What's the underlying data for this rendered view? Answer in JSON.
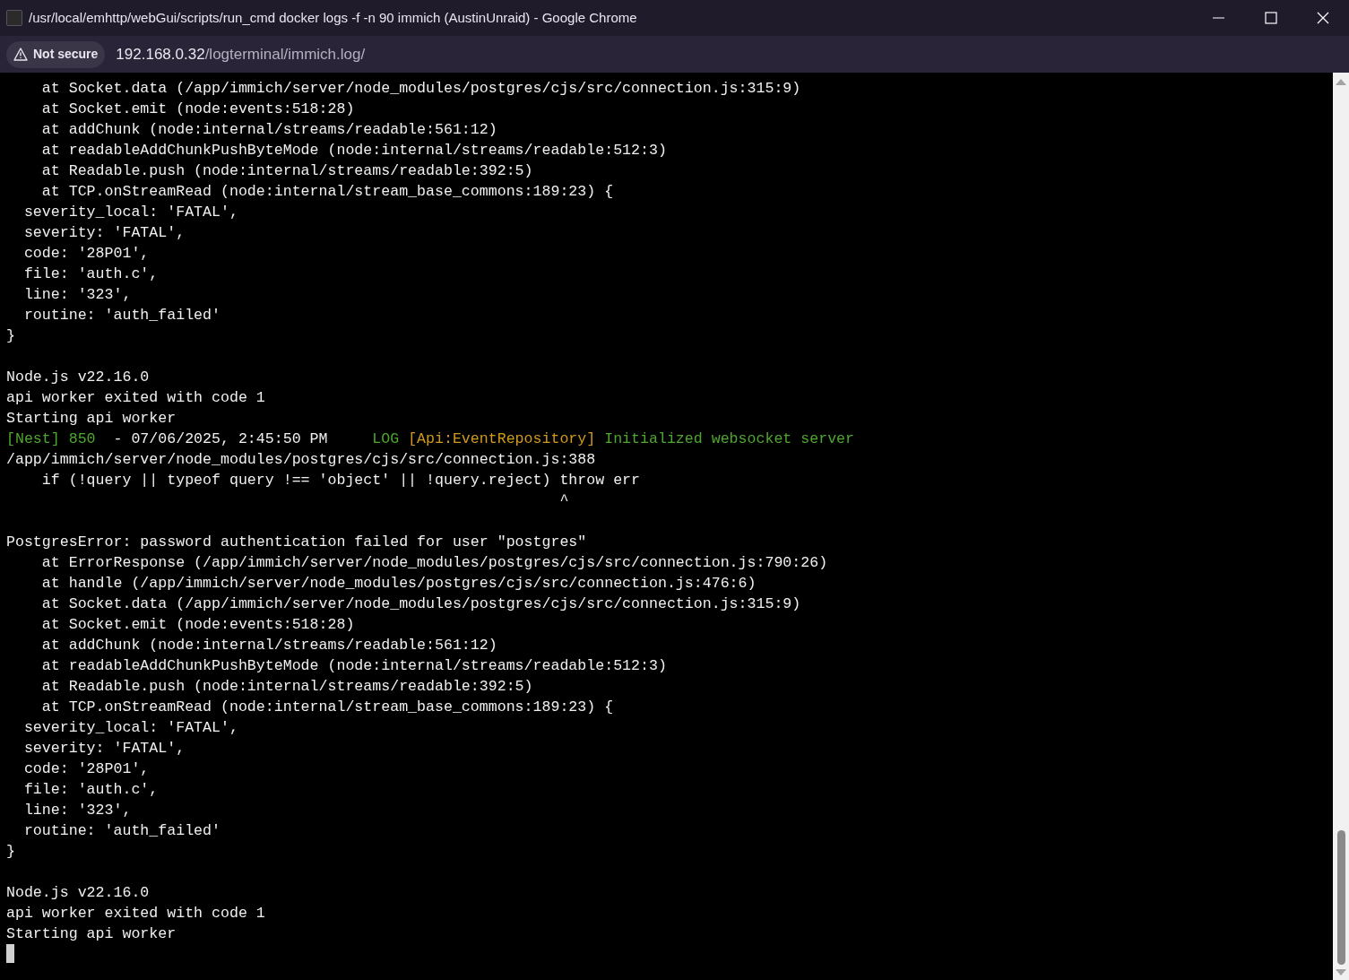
{
  "window": {
    "title": "/usr/local/emhttp/webGui/scripts/run_cmd docker logs -f -n 90 immich (AustinUnraid) - Google Chrome"
  },
  "address_bar": {
    "security": "Not secure",
    "url_host": "192.168.0.32",
    "url_path": "/logterminal/immich.log/"
  },
  "terminal": {
    "lines": [
      {
        "kind": "text",
        "text": "    at Socket.data (/app/immich/server/node_modules/postgres/cjs/src/connection.js:315:9)"
      },
      {
        "kind": "text",
        "text": "    at Socket.emit (node:events:518:28)"
      },
      {
        "kind": "text",
        "text": "    at addChunk (node:internal/streams/readable:561:12)"
      },
      {
        "kind": "text",
        "text": "    at readableAddChunkPushByteMode (node:internal/streams/readable:512:3)"
      },
      {
        "kind": "text",
        "text": "    at Readable.push (node:internal/streams/readable:392:5)"
      },
      {
        "kind": "text",
        "text": "    at TCP.onStreamRead (node:internal/stream_base_commons:189:23) {"
      },
      {
        "kind": "text",
        "text": "  severity_local: 'FATAL',"
      },
      {
        "kind": "text",
        "text": "  severity: 'FATAL',"
      },
      {
        "kind": "text",
        "text": "  code: '28P01',"
      },
      {
        "kind": "text",
        "text": "  file: 'auth.c',"
      },
      {
        "kind": "text",
        "text": "  line: '323',"
      },
      {
        "kind": "text",
        "text": "  routine: 'auth_failed'"
      },
      {
        "kind": "text",
        "text": "}"
      },
      {
        "kind": "blank"
      },
      {
        "kind": "text",
        "text": "Node.js v22.16.0"
      },
      {
        "kind": "text",
        "text": "api worker exited with code 1"
      },
      {
        "kind": "text",
        "text": "Starting api worker"
      },
      {
        "kind": "log",
        "parts": [
          {
            "text": "[Nest] 850  ",
            "color": "#4ea72e"
          },
          {
            "text": "- 07/06/2025, 2:45:50 PM     ",
            "color": "#f0f0f0"
          },
          {
            "text": "LOG ",
            "color": "#4ea72e"
          },
          {
            "text": "[Api:EventRepository] ",
            "color": "#d29a1a"
          },
          {
            "text": "Initialized websocket server",
            "color": "#4ea72e"
          }
        ]
      },
      {
        "kind": "text",
        "text": "/app/immich/server/node_modules/postgres/cjs/src/connection.js:388"
      },
      {
        "kind": "text",
        "text": "    if (!query || typeof query !== 'object' || !query.reject) throw err"
      },
      {
        "kind": "text",
        "text": "                                                              ^"
      },
      {
        "kind": "blank"
      },
      {
        "kind": "text",
        "text": "PostgresError: password authentication failed for user \"postgres\""
      },
      {
        "kind": "text",
        "text": "    at ErrorResponse (/app/immich/server/node_modules/postgres/cjs/src/connection.js:790:26)"
      },
      {
        "kind": "text",
        "text": "    at handle (/app/immich/server/node_modules/postgres/cjs/src/connection.js:476:6)"
      },
      {
        "kind": "text",
        "text": "    at Socket.data (/app/immich/server/node_modules/postgres/cjs/src/connection.js:315:9)"
      },
      {
        "kind": "text",
        "text": "    at Socket.emit (node:events:518:28)"
      },
      {
        "kind": "text",
        "text": "    at addChunk (node:internal/streams/readable:561:12)"
      },
      {
        "kind": "text",
        "text": "    at readableAddChunkPushByteMode (node:internal/streams/readable:512:3)"
      },
      {
        "kind": "text",
        "text": "    at Readable.push (node:internal/streams/readable:392:5)"
      },
      {
        "kind": "text",
        "text": "    at TCP.onStreamRead (node:internal/stream_base_commons:189:23) {"
      },
      {
        "kind": "text",
        "text": "  severity_local: 'FATAL',"
      },
      {
        "kind": "text",
        "text": "  severity: 'FATAL',"
      },
      {
        "kind": "text",
        "text": "  code: '28P01',"
      },
      {
        "kind": "text",
        "text": "  file: 'auth.c',"
      },
      {
        "kind": "text",
        "text": "  line: '323',"
      },
      {
        "kind": "text",
        "text": "  routine: 'auth_failed'"
      },
      {
        "kind": "text",
        "text": "}"
      },
      {
        "kind": "blank"
      },
      {
        "kind": "text",
        "text": "Node.js v22.16.0"
      },
      {
        "kind": "text",
        "text": "api worker exited with code 1"
      },
      {
        "kind": "text",
        "text": "Starting api worker"
      },
      {
        "kind": "cursor"
      }
    ]
  }
}
